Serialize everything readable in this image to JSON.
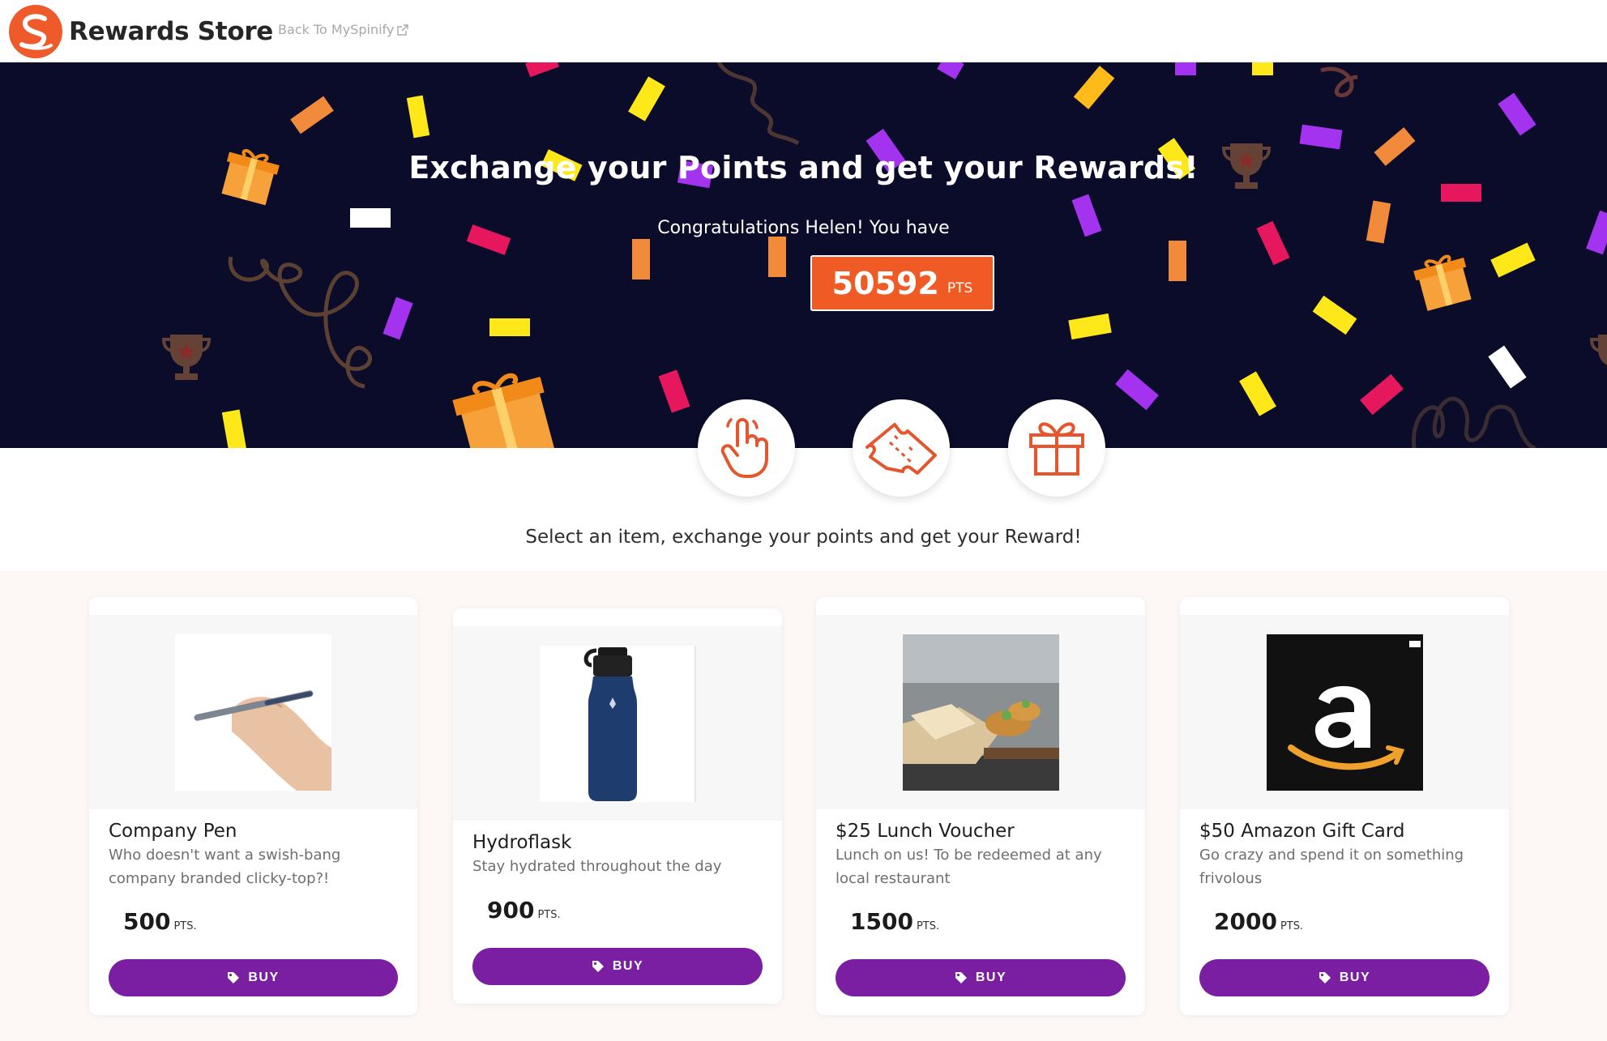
{
  "header": {
    "brand_name": "Rewards Store",
    "back_link_label": "Back To MySpinify",
    "logo_icon": "spinify-logo-icon",
    "external_icon": "external-link-icon"
  },
  "hero": {
    "title": "Exchange your Points and get your Rewards!",
    "subtitle": "Congratulations Helen! You have",
    "points_value": "50592",
    "points_unit": "PTS"
  },
  "steps": [
    {
      "icon": "hand-pointer-icon"
    },
    {
      "icon": "ticket-icon"
    },
    {
      "icon": "gift-icon"
    }
  ],
  "tagline": "Select an item, exchange your points and get your Reward!",
  "products": [
    {
      "title": "Company Pen",
      "description": "Who doesn't want a swish-bang company branded clicky-top?!",
      "price": "500",
      "unit": "PTS.",
      "buy_label": "BUY"
    },
    {
      "title": "Hydroflask",
      "description": "Stay hydrated throughout the day",
      "price": "900",
      "unit": "PTS.",
      "buy_label": "BUY"
    },
    {
      "title": "$25 Lunch Voucher",
      "description": "Lunch on us! To be redeemed at any local restaurant",
      "price": "1500",
      "unit": "PTS.",
      "buy_label": "BUY"
    },
    {
      "title": "$50 Amazon Gift Card",
      "description": "Go crazy and spend it on something frivolous",
      "price": "2000",
      "unit": "PTS.",
      "buy_label": "BUY"
    }
  ],
  "colors": {
    "accent_orange": "#f05a24",
    "hero_bg": "#0b0b2a",
    "buy_purple": "#7b1fa2"
  }
}
